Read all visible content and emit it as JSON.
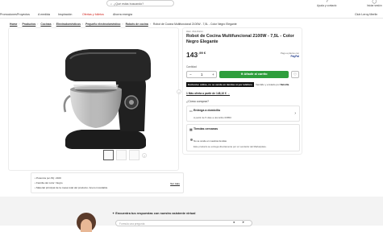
{
  "header": {
    "search_placeholder": "¿Qué estás buscando?",
    "help_label": "Ayuda y contacto",
    "login_label": "Iniciar sesión"
  },
  "nav": {
    "items": [
      "Promociones",
      "Proyectos",
      "A medida",
      "Inspiración",
      "Ofertas y folletos",
      "Ahorra energía"
    ],
    "club": "Club Leroy Merlin"
  },
  "breadcrumbs": [
    "Home",
    "Productos",
    "Cocinas",
    "Electrodomésticos",
    "Pequeño electrodoméstico",
    "Robots de cocina",
    "Robot de Cocina Multifuncional 2100W - 7,5L - Color Negro Elegante"
  ],
  "product": {
    "ref": "REF. 86445294",
    "title": "Robot de Cocina Multifuncional 2100W - 7,5L - Color Negro Elegante",
    "price_int": "143",
    "price_dec": ",99 €",
    "payment_note": "Pago a plazos con",
    "payment_brand": "PayPal",
    "qty_label": "Cantidad",
    "qty_value": "1",
    "add_to_cart": "Añadir al carrito",
    "exclusive_tag": "Exclusivo online, no se vende en tiendas ni por teléfono",
    "sold_by": "Vendido y enviado por",
    "seller": "Netsilla",
    "offers_link": "1 Más oferta a partir de 148,10 € →",
    "buy_where": "¿Cómo comprar?",
    "delivery_title": "Entrega a domicilio",
    "delivery_sub": "A partir de 5 días a domicilio 06850",
    "stores_title": "Tiendas cercanas",
    "stores_note1": "No se vende en nuestras tiendas",
    "stores_note2": "Este producto se entrega directamente por un vendedor del Marketplace."
  },
  "specs": {
    "items": [
      "Potencia (en W): 2100",
      "Familia del color: Negro",
      "Material principal de la masa total del producto: Acero inoxidable"
    ],
    "more": "Ver más"
  },
  "assistant": {
    "title": "Encuentra tus respuestas con nuestro asistente virtual",
    "placeholder": "Formula una pregunta"
  },
  "colors": {
    "accent_green": "#2e9e3c",
    "promo_red": "#d0231c",
    "paypal": "#1f3a8a"
  }
}
